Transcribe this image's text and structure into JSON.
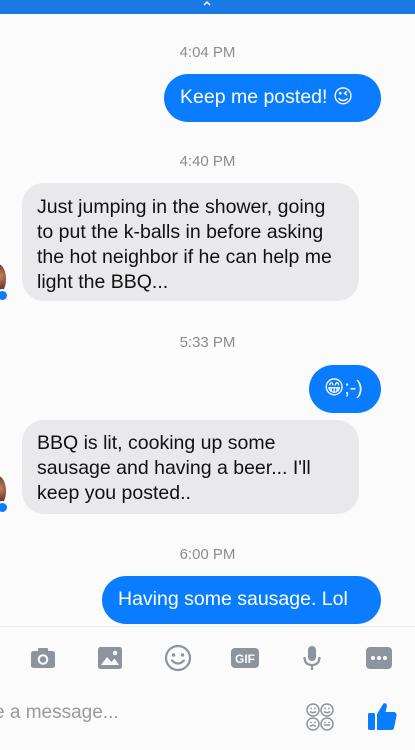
{
  "colors": {
    "accent": "#0a7cff",
    "incoming_bubble": "#e9e9eb",
    "timestamp": "#8a8d91",
    "toolbar_icon": "#8d949e"
  },
  "messages": [
    {
      "type": "timestamp",
      "text": "4:04 PM"
    },
    {
      "type": "outgoing",
      "text": "Keep me posted!",
      "emoji": "😉"
    },
    {
      "type": "timestamp",
      "text": "4:40 PM"
    },
    {
      "type": "incoming",
      "text": "Just jumping in the shower, going to put the k-balls in before asking the hot neighbor if he can help me light the BBQ..."
    },
    {
      "type": "timestamp",
      "text": "5:33 PM"
    },
    {
      "type": "outgoing",
      "emoji": "😁",
      "text": ";-)"
    },
    {
      "type": "incoming",
      "text": "BBQ is lit, cooking up some sausage and having a beer... I'll keep you posted.."
    },
    {
      "type": "timestamp",
      "text": "6:00 PM"
    },
    {
      "type": "outgoing",
      "text": "Having some sausage. Lol"
    }
  ],
  "toolbar": {
    "icons": [
      "camera-icon",
      "image-icon",
      "emoji-icon",
      "gif-icon",
      "microphone-icon",
      "more-icon"
    ],
    "gif_label": "GIF"
  },
  "composer": {
    "placeholder": "e a message...",
    "value": ""
  },
  "input_icons": [
    "emoji-keyboard-icon",
    "thumbs-up-icon"
  ]
}
